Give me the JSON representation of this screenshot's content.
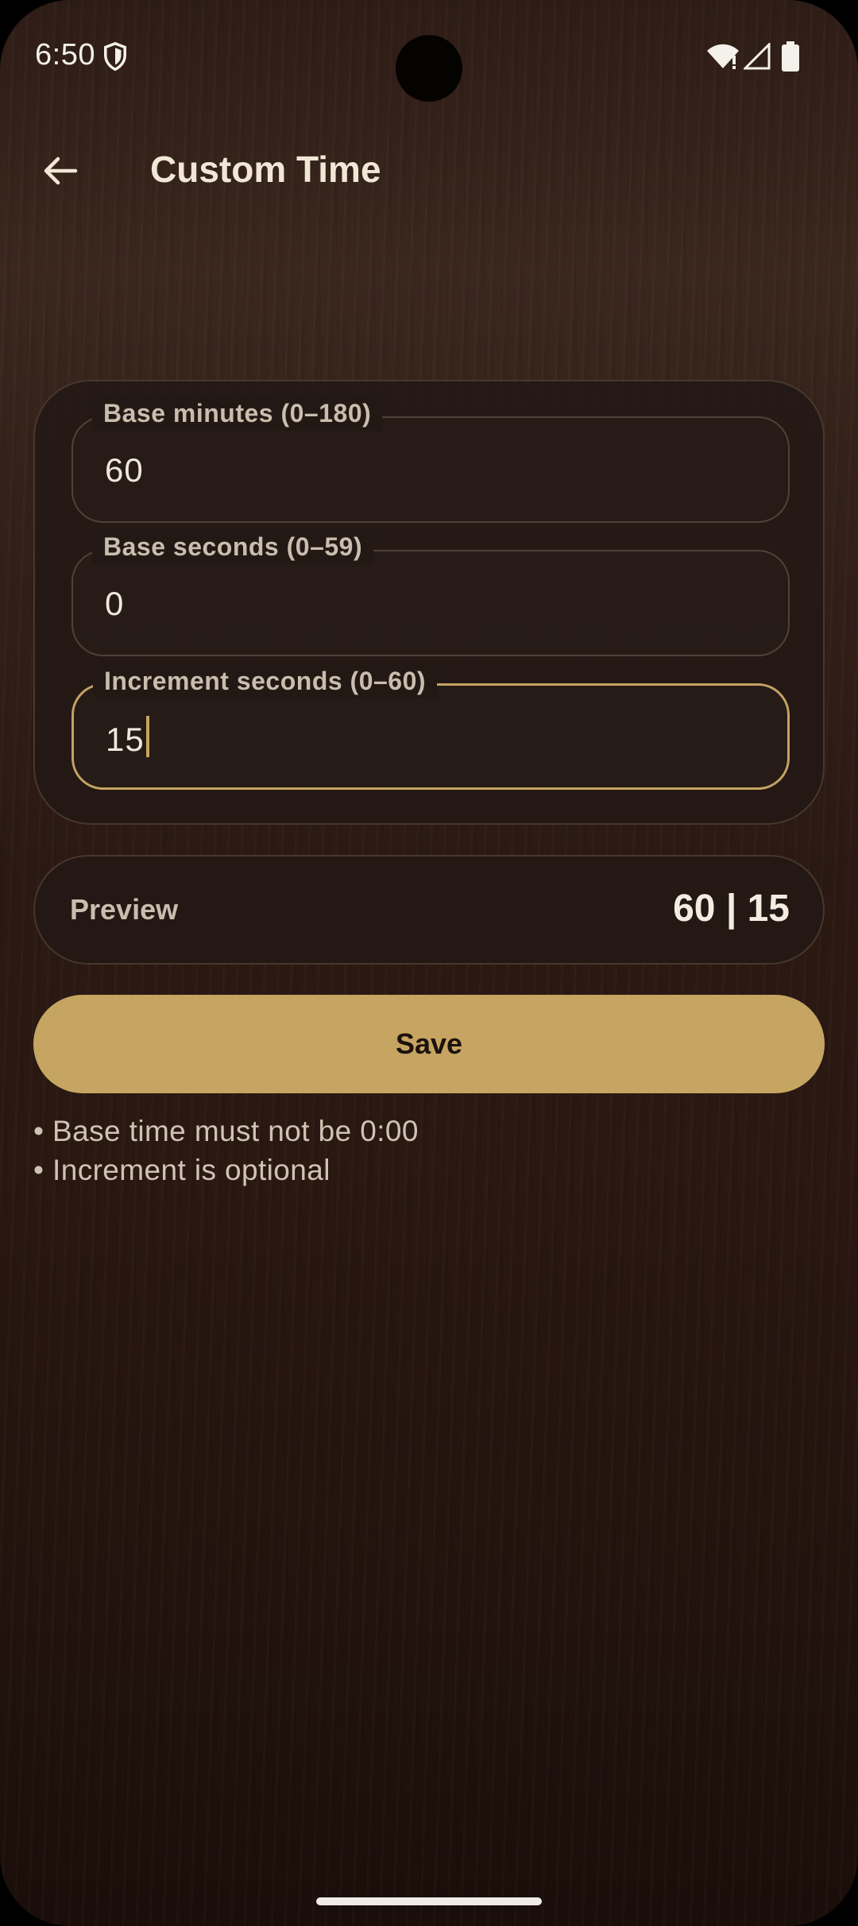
{
  "status_bar": {
    "time": "6:50",
    "icons": [
      "shield-icon",
      "wifi-icon",
      "signal-icon",
      "battery-icon"
    ]
  },
  "app_bar": {
    "back_icon": "arrow-left-icon",
    "title": "Custom Time"
  },
  "form": {
    "fields": [
      {
        "label": "Base minutes (0–180)",
        "value": "60",
        "focused": false
      },
      {
        "label": "Base seconds (0–59)",
        "value": "0",
        "focused": false
      },
      {
        "label": "Increment seconds (0–60)",
        "value": "15",
        "focused": true
      }
    ]
  },
  "preview": {
    "label": "Preview",
    "value": "60 | 15"
  },
  "save_button": {
    "label": "Save"
  },
  "notes": [
    "• Base time must not be 0:00",
    "• Increment is optional"
  ],
  "colors": {
    "accent": "#c6a462",
    "text_primary": "#f2e7d6",
    "text_secondary": "#c9bdad"
  }
}
